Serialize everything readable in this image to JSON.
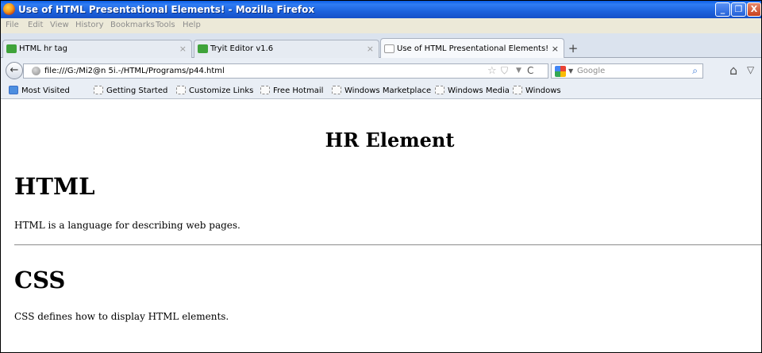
{
  "window": {
    "title": "Use of HTML Presentational Elements! - Mozilla Firefox",
    "minimize_label": "_",
    "maximize_label": "❐",
    "close_label": "X"
  },
  "menu": [
    "File",
    "Edit",
    "View",
    "History",
    "Bookmarks",
    "Tools",
    "Help"
  ],
  "tabs": [
    {
      "label": "HTML hr tag",
      "close": "×"
    },
    {
      "label": "Tryit Editor v1.6",
      "close": "×"
    },
    {
      "label": "Use of HTML Presentational Elements!",
      "close": "×"
    }
  ],
  "new_tab_label": "+",
  "navbar": {
    "back_icon": "←",
    "url": "file:///G:/Mi2@n 5i.-/HTML/Programs/p44.html",
    "star_icon": "☆",
    "pocket_icon": "⛉",
    "dropdown_icon": "▼",
    "reload_icon": "C",
    "search_placeholder": "Google",
    "search_engine_dropdown": "▼",
    "magnifier_icon": "⌕",
    "home_icon": "⌂",
    "pocket_button_icon": "▽"
  },
  "bookmarks": [
    "Most Visited",
    "Getting Started",
    "Customize Links",
    "Free Hotmail",
    "Windows Marketplace",
    "Windows Media",
    "Windows"
  ],
  "page": {
    "heading": "HR Element",
    "section1_heading": "HTML",
    "section1_text": "HTML is a language for describing web pages.",
    "section2_heading": "CSS",
    "section2_text": "CSS defines how to display HTML elements."
  },
  "colors": {
    "titlebar": "#1d63dd",
    "menubar": "#ece9d8",
    "toolbar": "#e9eef5",
    "tab_icon_green": "#3fa33a"
  }
}
